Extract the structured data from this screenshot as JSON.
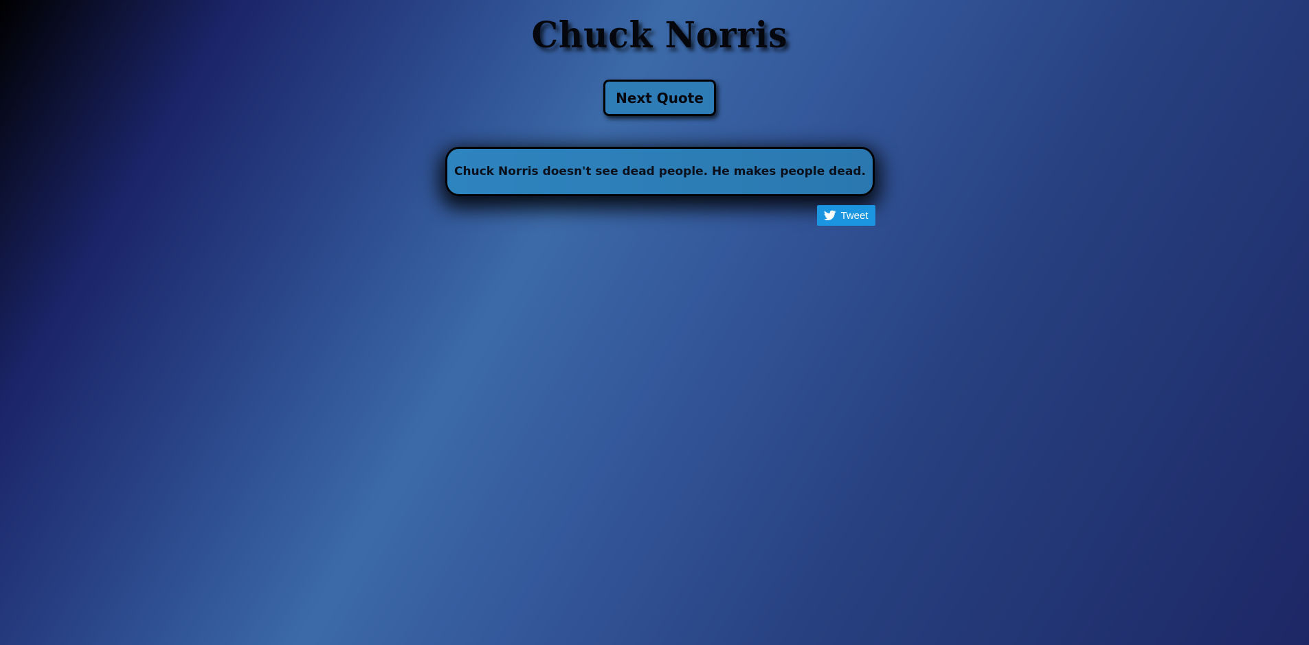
{
  "header": {
    "title": "Chuck Norris"
  },
  "controls": {
    "next_quote_label": "Next Quote",
    "tweet_label": "Tweet",
    "tweet_icon": "twitter-bird-icon"
  },
  "quote": {
    "text": "Chuck Norris doesn't see dead people. He makes people dead."
  },
  "colors": {
    "button_bg": "#2e7db6",
    "card_bg": "#2e84bf",
    "tweet_bg": "#1b95e0",
    "text": "#05070d"
  }
}
